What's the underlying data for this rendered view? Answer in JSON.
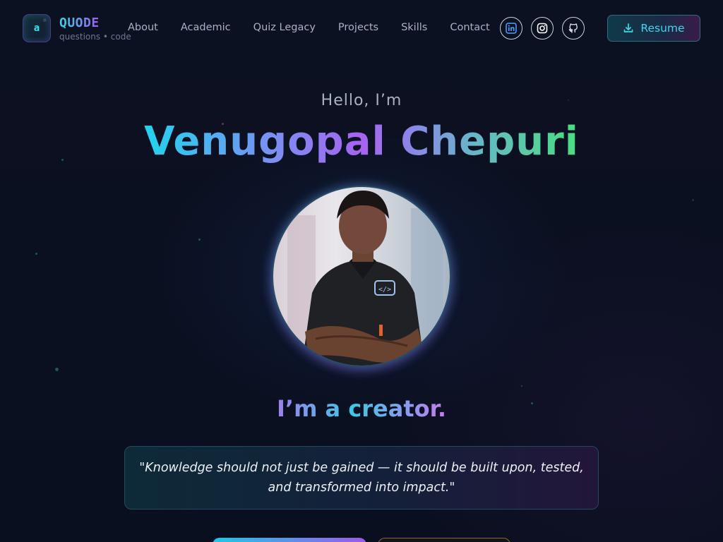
{
  "brand": {
    "logo_glyph": "a",
    "name": "QUODE",
    "tagline": "questions • code"
  },
  "nav": {
    "links": [
      "About",
      "Academic",
      "Quiz Legacy",
      "Projects",
      "Skills",
      "Contact"
    ]
  },
  "social": {
    "icons": [
      "linkedin-icon",
      "instagram-icon",
      "github-icon"
    ]
  },
  "resume": {
    "label": "Resume",
    "icon": "download-icon"
  },
  "hero": {
    "greeting": "Hello, I’m",
    "name": "Venugopal Chepuri",
    "role_line": "I’m a creator.",
    "quote": "\"Knowledge should not just be gained — it should be built upon, tested, and transformed into impact.\""
  },
  "colors": {
    "background": "#0b1020",
    "accent_cyan": "#22d3ee",
    "accent_purple": "#a663f0",
    "accent_green": "#4ade80"
  }
}
